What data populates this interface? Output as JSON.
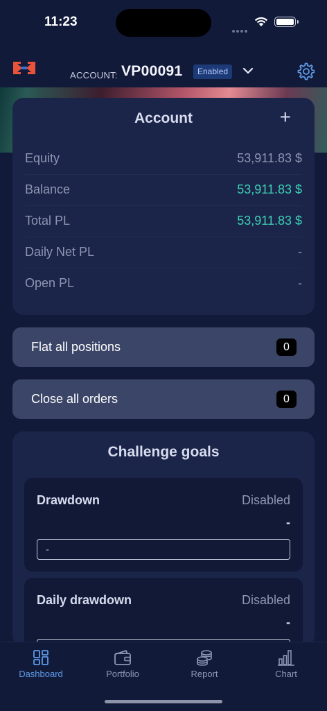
{
  "status": {
    "time": "11:23"
  },
  "header": {
    "account_label": "ACCOUNT:",
    "account_id": "VP00091",
    "badge": "Enabled",
    "icons": [
      "logo-icon",
      "chevron-down-icon",
      "gear-icon"
    ]
  },
  "account": {
    "title": "Account",
    "add": "+",
    "rows": [
      {
        "label": "Equity",
        "value": "53,911.83 $"
      },
      {
        "label": "Balance",
        "value": "53,911.83 $"
      },
      {
        "label": "Total PL",
        "value": "53,911.83 $"
      },
      {
        "label": "Daily Net PL",
        "value": "-"
      },
      {
        "label": "Open PL",
        "value": "-"
      }
    ]
  },
  "actions": {
    "flat": {
      "label": "Flat all positions",
      "count": "0"
    },
    "close": {
      "label": "Close all orders",
      "count": "0"
    }
  },
  "goals": {
    "title": "Challenge goals",
    "items": [
      {
        "name": "Drawdown",
        "status": "Disabled",
        "value": "-",
        "field": "-"
      },
      {
        "name": "Daily drawdown",
        "status": "Disabled",
        "value": "-",
        "field": ""
      }
    ]
  },
  "tabs": [
    {
      "label": "Dashboard",
      "icon": "dashboard-icon",
      "active": true
    },
    {
      "label": "Portfolio",
      "icon": "wallet-icon",
      "active": false
    },
    {
      "label": "Report",
      "icon": "coins-icon",
      "active": false
    },
    {
      "label": "Chart",
      "icon": "bar-chart-icon",
      "active": false
    }
  ],
  "colors": {
    "accent": "#5d9be8",
    "positive": "#3ed0b5",
    "card": "#1b2449",
    "background": "#121a3a"
  }
}
